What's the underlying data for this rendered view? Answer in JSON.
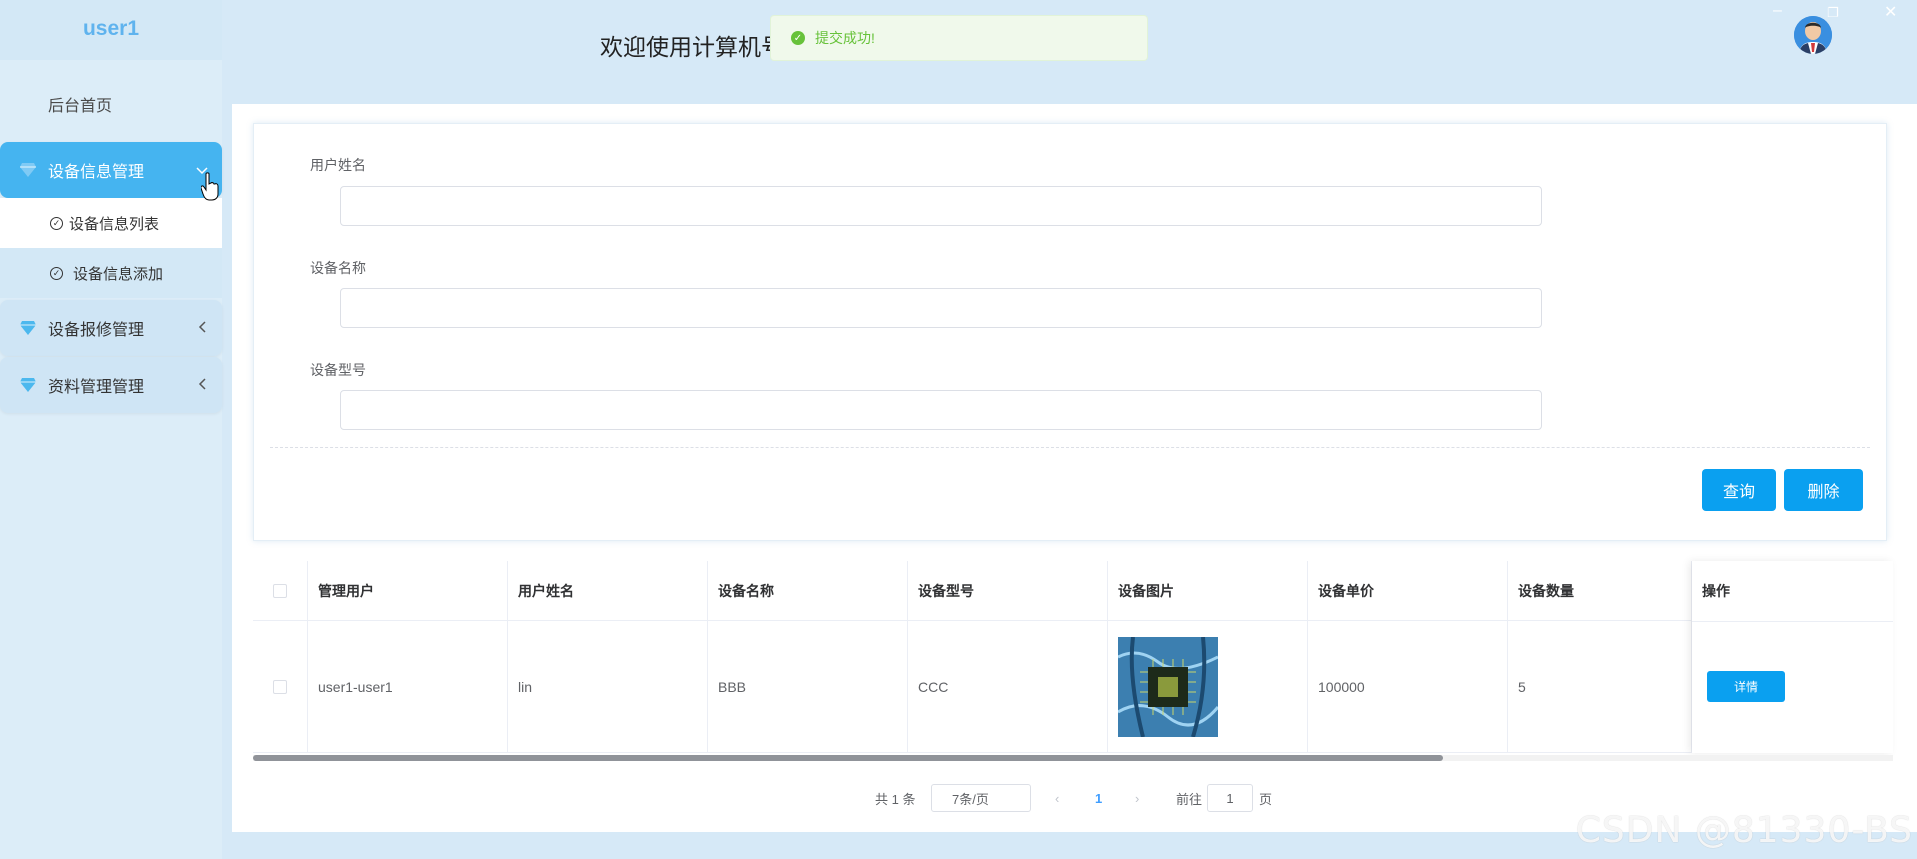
{
  "app": {
    "user_name": "user1",
    "welcome": "欢迎使用计算机号"
  },
  "toast": {
    "message": "提交成功!"
  },
  "sidebar": {
    "home": "后台首页",
    "groups": [
      {
        "label": "设备信息管理",
        "expanded": true,
        "children": [
          "设备信息列表",
          "设备信息添加"
        ]
      },
      {
        "label": "设备报修管理",
        "expanded": false
      },
      {
        "label": "资料管理管理",
        "expanded": false
      }
    ]
  },
  "form": {
    "fields": [
      {
        "label": "用户姓名",
        "value": ""
      },
      {
        "label": "设备名称",
        "value": ""
      },
      {
        "label": "设备型号",
        "value": ""
      }
    ],
    "query_button": "查询",
    "delete_button": "删除"
  },
  "table": {
    "columns": [
      "管理用户",
      "用户姓名",
      "设备名称",
      "设备型号",
      "设备图片",
      "设备单价",
      "设备数量",
      "操作"
    ],
    "rows": [
      {
        "admin_user": "user1-user1",
        "user_name": "lin",
        "device_name": "BBB",
        "device_model": "CCC",
        "device_image": "chip-image",
        "unit_price": "100000",
        "quantity": "5",
        "action": "详情"
      }
    ]
  },
  "pagination": {
    "total": "共 1 条",
    "page_size": "7条/页",
    "current_page": "1",
    "goto_label": "前往",
    "goto_value": "1",
    "page_suffix": "页"
  },
  "watermark": "CSDN @81330-BS",
  "colors": {
    "accent": "#0aa0f0",
    "active_menu": "#45b4f0",
    "success": "#67c23a"
  }
}
